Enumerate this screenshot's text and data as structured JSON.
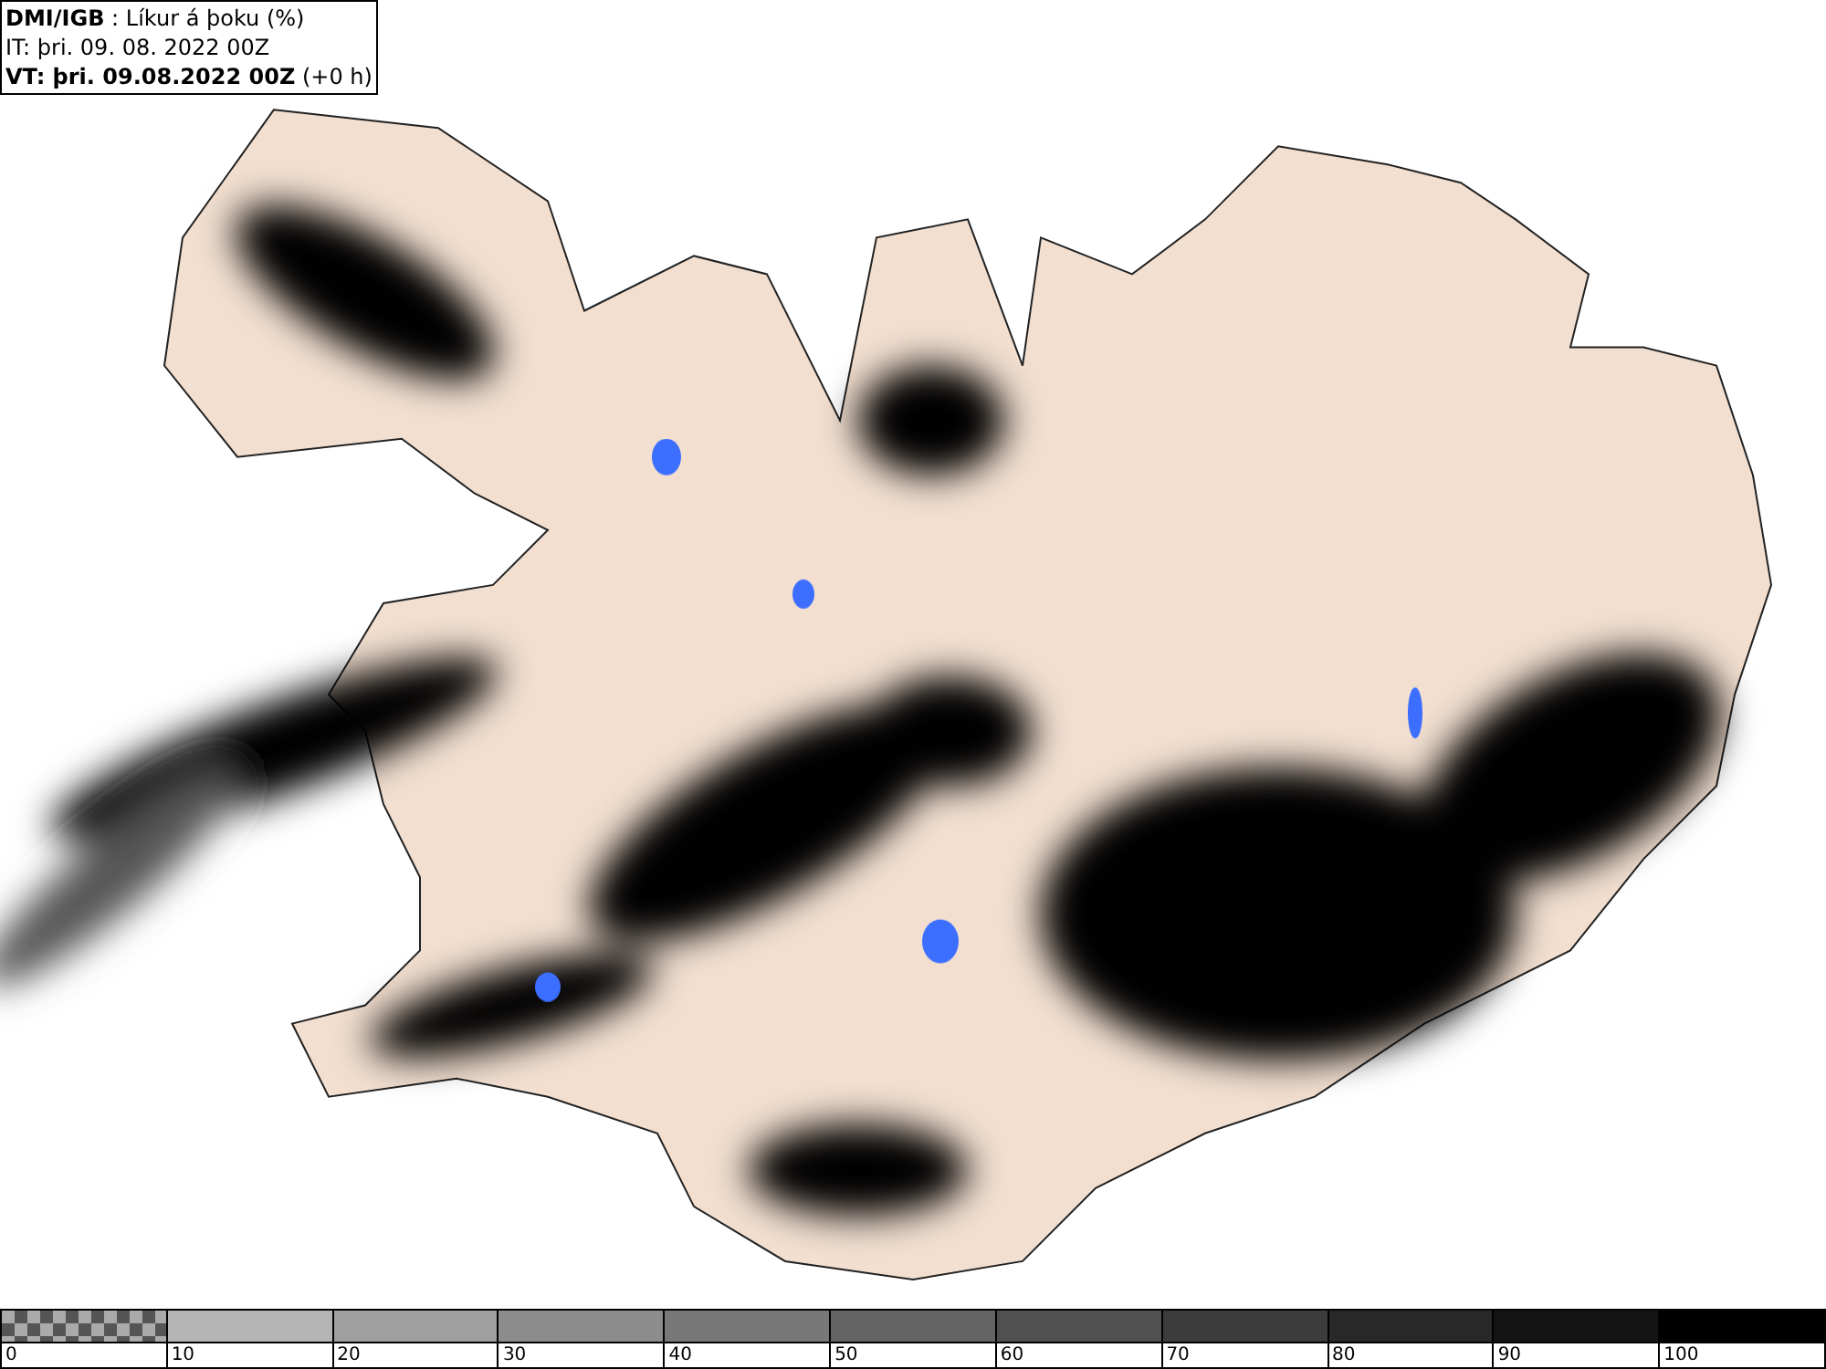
{
  "header": {
    "line_1": "**DMI/IGB** : Líkur á þoku (%)",
    "line_2": "IT: þri. 09. 08. 2022 00Z",
    "line_3": "**VT: þri. 09.08.2022 00Z** (+0 h)"
  },
  "legend": {
    "items": [
      {
        "label": "0",
        "kind": "checker"
      },
      {
        "label": "10",
        "kind": "solid",
        "color": "#b4b4b4"
      },
      {
        "label": "20",
        "kind": "solid",
        "color": "#a0a0a0"
      },
      {
        "label": "30",
        "kind": "solid",
        "color": "#8c8c8c"
      },
      {
        "label": "40",
        "kind": "solid",
        "color": "#787878"
      },
      {
        "label": "50",
        "kind": "solid",
        "color": "#646464"
      },
      {
        "label": "60",
        "kind": "solid",
        "color": "#505050"
      },
      {
        "label": "70",
        "kind": "solid",
        "color": "#3c3c3c"
      },
      {
        "label": "80",
        "kind": "solid",
        "color": "#282828"
      },
      {
        "label": "90",
        "kind": "solid",
        "color": "#141414"
      },
      {
        "label": "100",
        "kind": "solid",
        "color": "#000000"
      }
    ]
  }
}
